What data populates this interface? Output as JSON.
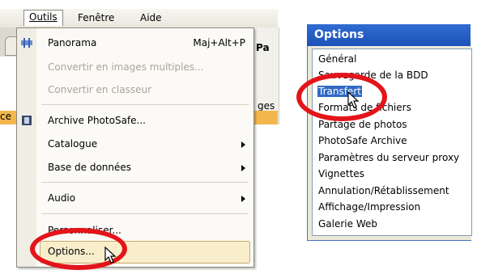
{
  "menubar": {
    "outils": "Outils",
    "fenetre": "Fenêtre",
    "aide": "Aide"
  },
  "background": {
    "pa": "Pa",
    "ges": "ges",
    "ce": "ce"
  },
  "menu": {
    "items": [
      {
        "label": "Panorama",
        "shortcut": "Maj+Alt+P",
        "enabled": true,
        "icon": "panorama-icon"
      },
      {
        "label": "Convertir en images multiples...",
        "enabled": false
      },
      {
        "label": "Convertir en classeur",
        "enabled": false
      },
      {
        "label": "Archive PhotoSafe...",
        "enabled": true,
        "icon": "photosafe-icon"
      },
      {
        "label": "Catalogue",
        "enabled": true,
        "submenu": true
      },
      {
        "label": "Base de données",
        "enabled": true,
        "submenu": true
      },
      {
        "label": "Audio",
        "enabled": true,
        "submenu": true
      },
      {
        "label": "Personnaliser...",
        "enabled": true
      },
      {
        "label": "Options...",
        "enabled": true,
        "highlighted": true
      }
    ]
  },
  "options_dialog": {
    "title": "Options",
    "items": [
      "Général",
      "Sauvegarde de la BDD",
      "Transfert",
      "Formats de fichiers",
      "Partage de photos",
      "PhotoSafe Archive",
      "Paramètres du serveur proxy",
      "Vignettes",
      "Annulation/Rétablissement",
      "Affichage/Impression",
      "Galerie Web"
    ],
    "selected": "Transfert"
  },
  "colors": {
    "annotation_ring": "#e3141a",
    "selection": "#316ac5",
    "titlebar": "#2f6dd1",
    "menu_highlight": "#f8eecc"
  }
}
